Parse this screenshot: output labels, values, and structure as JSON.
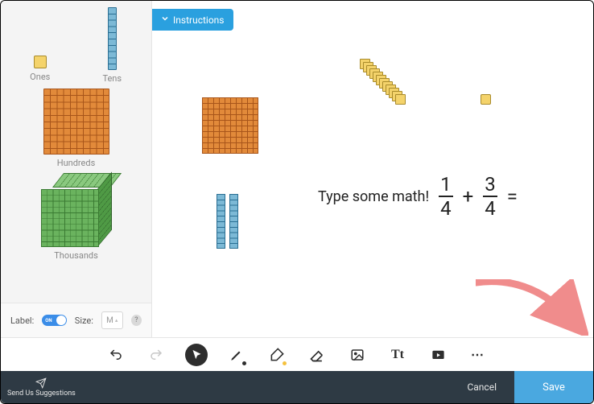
{
  "instructions_label": "Instructions",
  "palette": {
    "ones": "Ones",
    "tens": "Tens",
    "hundreds": "Hundreds",
    "thousands": "Thousands"
  },
  "sidebar_controls": {
    "label_text": "Label:",
    "label_toggle": "ON",
    "size_text": "Size:",
    "size_value": "M"
  },
  "canvas": {
    "math_prompt": "Type some math!",
    "fraction1": {
      "num": "1",
      "den": "4"
    },
    "plus": "+",
    "fraction2": {
      "num": "3",
      "den": "4"
    },
    "equals": "="
  },
  "toolbar": {
    "undo": "undo",
    "redo": "redo",
    "select": "select",
    "pen": "pen",
    "highlighter": "highlighter",
    "eraser": "eraser",
    "image": "image",
    "text": "text",
    "video": "video",
    "more": "more"
  },
  "footer": {
    "suggestions": "Send Us Suggestions",
    "cancel": "Cancel",
    "save": "Save"
  },
  "colors": {
    "accent_blue": "#2aa0df",
    "pen_dot": "#2e2e2e",
    "highlighter_dot": "#f5c13d",
    "arrow": "#f08c8c"
  }
}
